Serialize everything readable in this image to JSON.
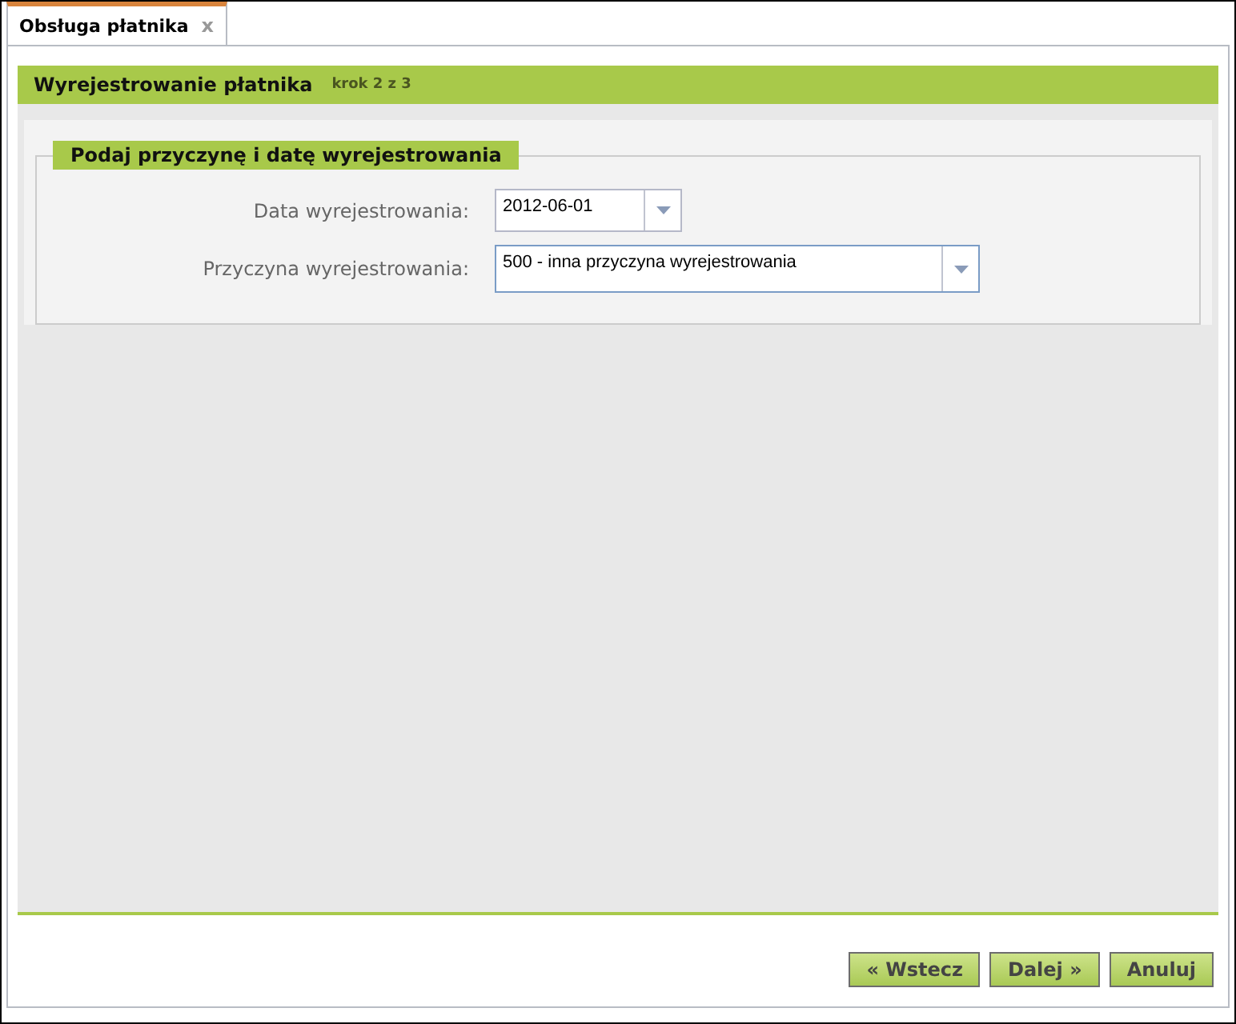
{
  "tab": {
    "label": "Obsługa płatnika",
    "close": "x",
    "selected": true
  },
  "header": {
    "title": "Wyrejestrowanie płatnika",
    "step": "krok 2 z 3"
  },
  "fieldset": {
    "legend": "Podaj przyczynę i datę wyrejestrowania",
    "fields": [
      {
        "label": "Data wyrejestrowania:",
        "value": "2012-06-01",
        "kind": "date"
      },
      {
        "label": "Przyczyna wyrejestrowania:",
        "value": "500 - inna przyczyna wyrejestrowania",
        "kind": "combo"
      }
    ]
  },
  "buttons": [
    "« Wstecz",
    "Dalej »",
    "Anuluj"
  ]
}
